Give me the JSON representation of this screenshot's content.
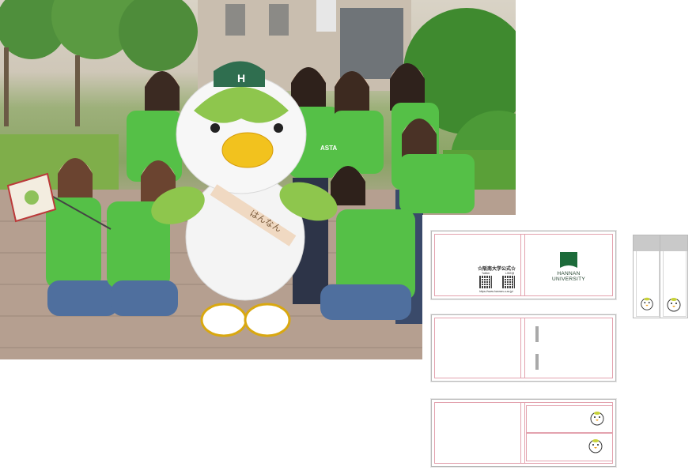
{
  "photo": {
    "mascot_sash_text": "はんなん",
    "mascot_cap_letter": "H",
    "shirt_text": "ASTA"
  },
  "products": {
    "card_front": {
      "qr_title": "☆阪南大学公式☆",
      "qr_left_caption": "Twitter",
      "qr_right_caption": "LINE@",
      "url": "https://www.hannan-u.ac.jp/",
      "logo_line1": "HANNAN",
      "logo_line2": "UNIVERSITY"
    }
  },
  "colors": {
    "card_border": "#e3a2ae",
    "logo_green": "#1c6b3a",
    "shirt_green": "#55c047"
  }
}
